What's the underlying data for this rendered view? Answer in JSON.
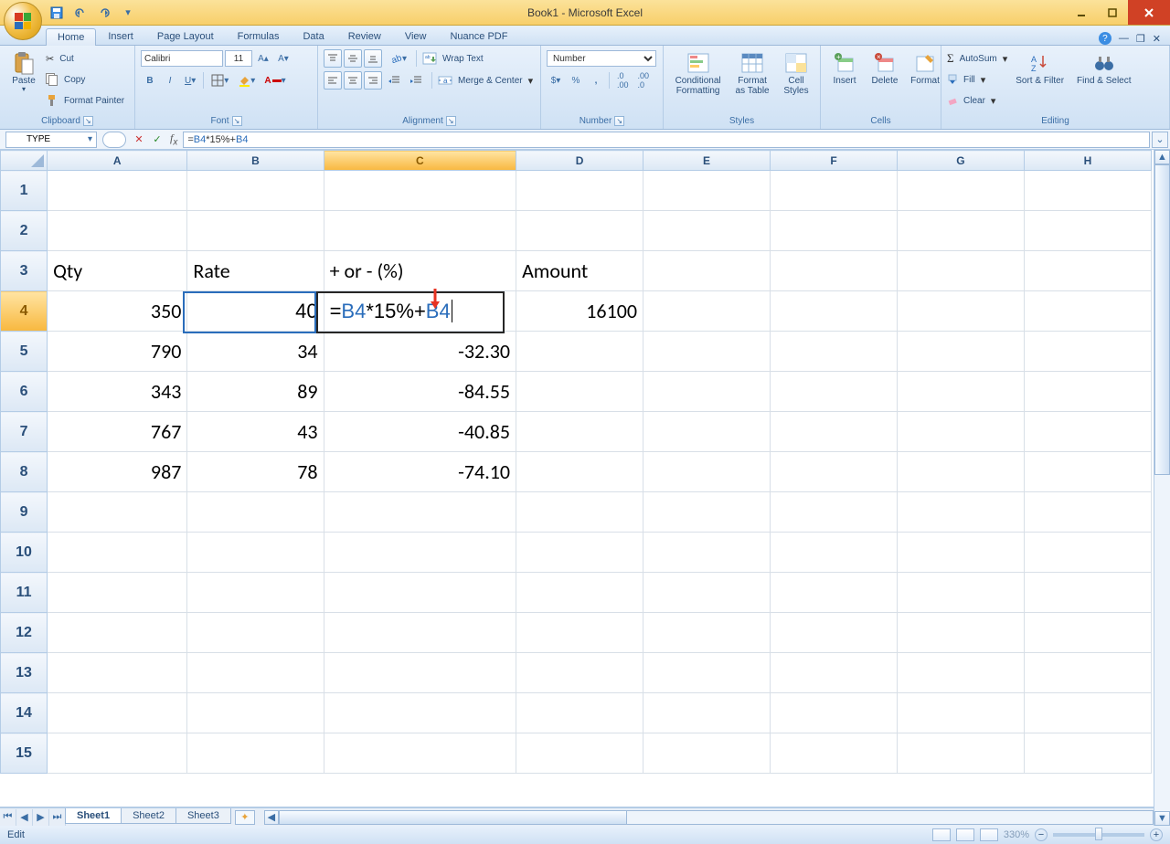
{
  "window": {
    "title": "Book1 - Microsoft Excel"
  },
  "tabs": {
    "items": [
      "Home",
      "Insert",
      "Page Layout",
      "Formulas",
      "Data",
      "Review",
      "View",
      "Nuance PDF"
    ],
    "active": "Home"
  },
  "clipboard": {
    "paste": "Paste",
    "cut": "Cut",
    "copy": "Copy",
    "fp": "Format Painter",
    "label": "Clipboard"
  },
  "font": {
    "name": "Calibri",
    "size": "11",
    "label": "Font"
  },
  "alignment": {
    "wrap": "Wrap Text",
    "merge": "Merge & Center",
    "label": "Alignment"
  },
  "number": {
    "format": "Number",
    "label": "Number"
  },
  "styles": {
    "cf": "Conditional Formatting",
    "fat": "Format as Table",
    "cs": "Cell Styles",
    "label": "Styles"
  },
  "cells": {
    "ins": "Insert",
    "del": "Delete",
    "fmt": "Format",
    "label": "Cells"
  },
  "editing": {
    "sum": "AutoSum",
    "fill": "Fill",
    "clear": "Clear",
    "sort": "Sort & Filter",
    "find": "Find & Select",
    "label": "Editing"
  },
  "formula_bar": {
    "name_box": "TYPE",
    "formula_display": "=B4*15%+B4",
    "formula_parts": {
      "p1": "=",
      "p2": "B4",
      "p3": "*15%+",
      "p4": "B4"
    }
  },
  "columns": [
    "A",
    "B",
    "C",
    "D",
    "E",
    "F",
    "G",
    "H"
  ],
  "row_headers": [
    "1",
    "2",
    "3",
    "4",
    "5",
    "6",
    "7",
    "8",
    "9",
    "10",
    "11",
    "12",
    "13",
    "14",
    "15"
  ],
  "grid": {
    "r3": {
      "A": "Qty",
      "B": "Rate",
      "C": "+ or - (%)",
      "D": "Amount"
    },
    "r4": {
      "A": "350",
      "B": "40",
      "C_parts": {
        "eq": "=",
        "ref1": "B4",
        "mid": "*15%+",
        "ref2": "B4"
      },
      "D": "16100"
    },
    "r5": {
      "A": "790",
      "B": "34",
      "C": "-32.30"
    },
    "r6": {
      "A": "343",
      "B": "89",
      "C": "-84.55"
    },
    "r7": {
      "A": "767",
      "B": "43",
      "C": "-40.85"
    },
    "r8": {
      "A": "987",
      "B": "78",
      "C": "-74.10"
    }
  },
  "sheets": {
    "items": [
      "Sheet1",
      "Sheet2",
      "Sheet3"
    ],
    "active": "Sheet1"
  },
  "status": {
    "mode": "Edit",
    "zoom": "330%"
  }
}
